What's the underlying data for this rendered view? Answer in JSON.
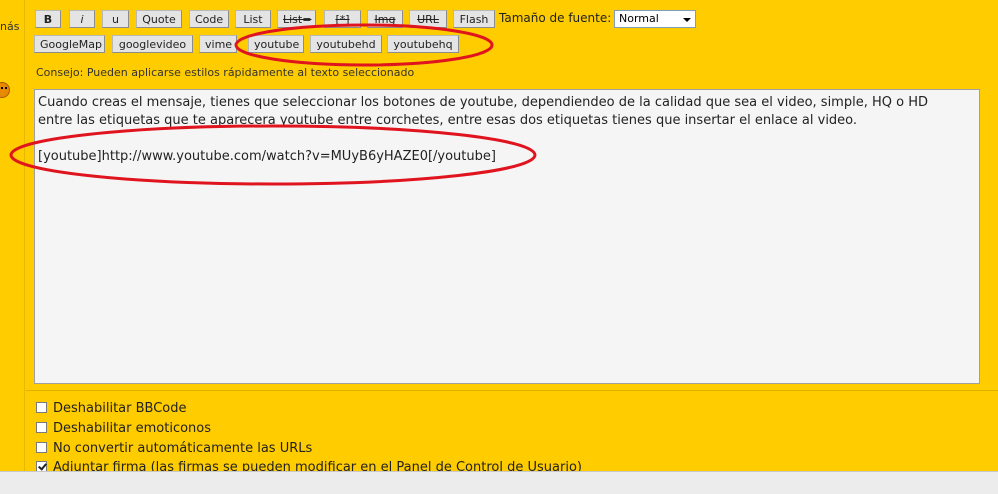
{
  "left_column": {
    "mas_fragment": "nás"
  },
  "toolbar": {
    "row1": [
      "B",
      "i",
      "u",
      "Quote",
      "Code",
      "List",
      "List=",
      "[*]",
      "Img",
      "URL",
      "Flash"
    ],
    "row2": [
      "GoogleMap",
      "googlevideo",
      "vime",
      "youtube",
      "youtubehd",
      "youtubehq"
    ],
    "font_size_label": "Tamaño de fuente:",
    "font_size_value": "Normal"
  },
  "tip": "Consejo: Pueden aplicarse estilos rápidamente al texto seleccionado",
  "editor": {
    "line1": "Cuando creas el mensaje, tienes que seleccionar  los botones de youtube, dependiendeo de la calidad que sea el video, simple, HQ o HD",
    "line2": "entre las etiquetas que te aparecera youtube entre corchetes, entre esas dos etiquetas tienes que insertar el enlace al video.",
    "line3": "[youtube]http://www.youtube.com/watch?v=MUyB6yHAZE0[/youtube]"
  },
  "options": [
    {
      "label": "Deshabilitar BBCode",
      "checked": false
    },
    {
      "label": "Deshabilitar emoticonos",
      "checked": false
    },
    {
      "label": "No convertir automáticamente las URLs",
      "checked": false
    },
    {
      "label": "Adjuntar firma (las firmas se pueden modificar en el Panel de Control de Usuario)",
      "checked": true
    }
  ],
  "colors": {
    "background": "#ffcc00",
    "annotation": "#e0141e"
  }
}
